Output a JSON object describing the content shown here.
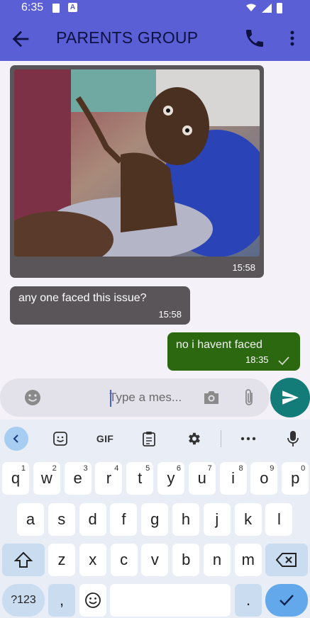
{
  "status_bar": {
    "time": "6:35",
    "a_icon": "A"
  },
  "app_bar": {
    "title": "PARENTS GROUP",
    "back_icon": "arrow-back-icon",
    "call_icon": "phone-icon",
    "more_icon": "more-vert-icon"
  },
  "colors": {
    "app_bar": "#5b5fd6",
    "incoming_bubble": "#5a5559",
    "outgoing_bubble": "#2c6810",
    "send_button": "#137c79"
  },
  "messages": [
    {
      "type": "image",
      "direction": "incoming",
      "time": "15:58"
    },
    {
      "type": "text",
      "direction": "incoming",
      "text": "any one faced this issue?",
      "time": "15:58"
    },
    {
      "type": "text",
      "direction": "outgoing",
      "text": "no i havent faced",
      "time": "18:35",
      "status": "sent"
    }
  ],
  "composer": {
    "placeholder": "Type a mes..."
  },
  "keyboard": {
    "toolbar": {
      "gif_label": "GIF"
    },
    "row1": [
      {
        "k": "q",
        "h": "1"
      },
      {
        "k": "w",
        "h": "2"
      },
      {
        "k": "e",
        "h": "3"
      },
      {
        "k": "r",
        "h": "4"
      },
      {
        "k": "t",
        "h": "5"
      },
      {
        "k": "y",
        "h": "6"
      },
      {
        "k": "u",
        "h": "7"
      },
      {
        "k": "i",
        "h": "8"
      },
      {
        "k": "o",
        "h": "9"
      },
      {
        "k": "p",
        "h": "0"
      }
    ],
    "row2": [
      "a",
      "s",
      "d",
      "f",
      "g",
      "h",
      "j",
      "k",
      "l"
    ],
    "row3": [
      "z",
      "x",
      "c",
      "v",
      "b",
      "n",
      "m"
    ],
    "sym_label": "?123",
    "comma": ",",
    "period": "."
  }
}
